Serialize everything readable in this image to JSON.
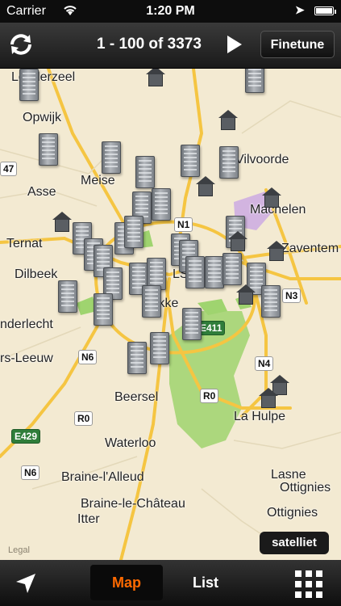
{
  "status_bar": {
    "carrier": "Carrier",
    "time": "1:20 PM",
    "battery_level_percent": 90
  },
  "nav": {
    "counter": "1 - 100 of 3373",
    "finetune_label": "Finetune",
    "refresh_icon": "refresh-icon",
    "next_icon": "play-icon"
  },
  "map": {
    "places": {
      "londerzeel": "Londerzeel",
      "opwijk": "Opwijk",
      "meise": "Meise",
      "asse": "Asse",
      "vilvoorde": "Vilvoorde",
      "machelen": "Machelen",
      "ternat": "Ternat",
      "zaventem": "Zaventem",
      "dilbeek": "Dilbeek",
      "anderlecht": "nderlecht",
      "leeuw": "rs-Leeuw",
      "uccle": "Ukke",
      "beersel": "Beersel",
      "la_hulpe": "La Hulpe",
      "waterloo": "Waterloo",
      "braine_alleud": "Braine-l'Alleud",
      "braine_chateau": "Braine-le-Château",
      "itter": "Itter",
      "lasne": "Lasne",
      "ottignies": "Ottignies",
      "ottignies2": "Ottignies",
      "bxl_partial": "LS"
    },
    "roads": {
      "n1": "N1",
      "n3": "N3",
      "n4": "N4",
      "n6a": "N6",
      "n6b": "N6",
      "r0a": "R0",
      "r0b": "R0",
      "e411": "E411",
      "e429": "E429",
      "n47": "47"
    },
    "satellite_label": "satelliet",
    "legal_label": "Legal",
    "colors": {
      "land": "#f3ead2",
      "road": "#f5c542",
      "green": "#9fd46f",
      "industrial": "#c9a6e3"
    }
  },
  "tabbar": {
    "location_icon": "location-arrow-icon",
    "map_label": "Map",
    "list_label": "List",
    "grid_icon": "grid-icon",
    "active_color": "#ff6a00"
  }
}
